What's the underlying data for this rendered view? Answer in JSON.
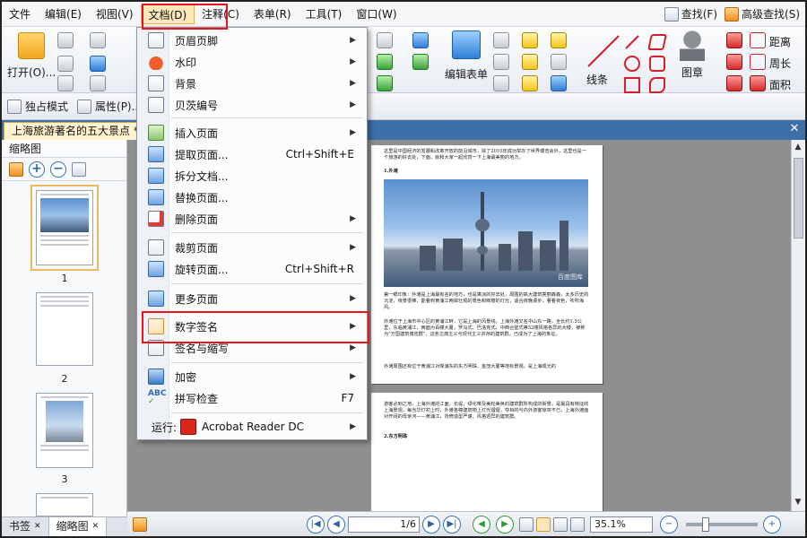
{
  "menubar": {
    "items": [
      "文件",
      "编辑(E)",
      "视图(V)",
      "文档(D)",
      "注释(C)",
      "表单(R)",
      "工具(T)",
      "窗口(W)"
    ],
    "find_label": "查找(F)",
    "advanced_find_label": "高级查找(S)"
  },
  "ribbon": {
    "open_label": "打开(O)...",
    "edit_form_label": "编辑表单",
    "line_label": "线条",
    "stamp_label": "图章",
    "distance_label": "距离",
    "perimeter_label": "周长",
    "area_label": "面积",
    "exclusive_mode_label": "独占模式",
    "properties_label": "属性(P)..."
  },
  "document_tab": {
    "title": "上海旅游著名的五大景点 *"
  },
  "left_panel": {
    "title": "缩略图",
    "thumbnail_numbers": [
      "1",
      "2",
      "3"
    ],
    "bottom_tabs": [
      "书签",
      "缩略图"
    ]
  },
  "dropdown": {
    "items": [
      {
        "label": "页眉页脚",
        "shortcut": "",
        "submenu": true,
        "icon": "header-footer-icon"
      },
      {
        "label": "水印",
        "shortcut": "",
        "submenu": true,
        "icon": "watermark-icon"
      },
      {
        "label": "背景",
        "shortcut": "",
        "submenu": true,
        "icon": "background-icon"
      },
      {
        "label": "贝茨编号",
        "shortcut": "",
        "submenu": true,
        "icon": "bates-number-icon"
      },
      {
        "label": "插入页面",
        "shortcut": "",
        "submenu": true,
        "icon": "insert-page-icon"
      },
      {
        "label": "提取页面...",
        "shortcut": "Ctrl+Shift+E",
        "submenu": false,
        "icon": "extract-page-icon"
      },
      {
        "label": "拆分文档...",
        "shortcut": "",
        "submenu": false,
        "icon": "split-document-icon"
      },
      {
        "label": "替换页面...",
        "shortcut": "",
        "submenu": false,
        "icon": "replace-page-icon"
      },
      {
        "label": "删除页面",
        "shortcut": "",
        "submenu": true,
        "icon": "delete-page-icon"
      },
      {
        "label": "裁剪页面",
        "shortcut": "",
        "submenu": true,
        "icon": "crop-page-icon"
      },
      {
        "label": "旋转页面...",
        "shortcut": "Ctrl+Shift+R",
        "submenu": false,
        "icon": "rotate-page-icon"
      },
      {
        "label": "更多页面",
        "shortcut": "",
        "submenu": true,
        "icon": "more-pages-icon"
      },
      {
        "label": "数字签名",
        "shortcut": "",
        "submenu": true,
        "icon": "digital-signature-icon"
      },
      {
        "label": "签名与缩写",
        "shortcut": "",
        "submenu": true,
        "icon": "sign-initials-icon"
      },
      {
        "label": "加密",
        "shortcut": "",
        "submenu": true,
        "icon": "encrypt-icon"
      },
      {
        "label": "拼写检查",
        "shortcut": "F7",
        "submenu": false,
        "icon": "spell-check-icon"
      },
      {
        "label": "运行:",
        "shortcut": "",
        "submenu": true,
        "icon": ""
      }
    ],
    "run_app": "Acrobat Reader DC"
  },
  "page_content": {
    "intro_text": "这里是中国经济的发展和改革开放的前沿城市，除了2010年成功举办了世界博览会外，这里也是一个旅游的好去处，下面，就和大家一起欣赏一下上海最美丽的地方。",
    "section1_title": "1.外滩",
    "photo_watermark": "百度图库",
    "para1": "第一眼印象：外滩是上海最有名的地方，也是乘凉的好去处，周围的高大建筑亮丽森森，太多历史的沉淀，夜景很棒，能看到黄浦江两岸壮观的景色和绚丽的灯光，适合夜晚漫步，看看夜色，吹吹海风。",
    "para2": "外滩位于上海市中心区的黄浦江畔，它是上海的风景线，上海外滩又名中山东一路，全长约1.5公里，东临黄浦江，西面为百幢大厦，罗马式、巴洛克式、中西合璧式等52幢风格各异的大楼，被称为\"万国建筑博览群\"，这些古典主义与现代主义并存的建筑群，已成为了上海的象征。",
    "para3": "外滩周围还有位于黄浦江对岸浦东的东方明珠、金茂大厦等地标景观，是上海观光的",
    "page2_para": "游客必到之地，上海外滩的江面，长堤，绿化带及美轮美奂的建筑群所构成的街景，是最具有特征的上海景观，每当华灯初上时，外滩各幢建筑物上灯光熠熠，夺目的与内外游客惊叹不已，上海外滩面对开阔的母亲河——黄浦江，背倚造型严谨、风格迥异的建筑群。",
    "section2_title": "2.东方明珠"
  },
  "statusbar": {
    "page_value": "1",
    "page_total": "6",
    "zoom_value": "35.1%"
  }
}
